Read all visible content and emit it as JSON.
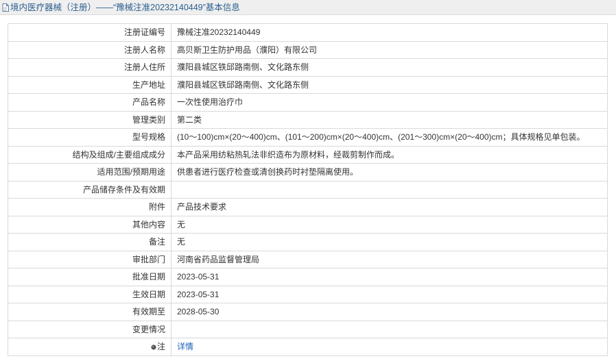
{
  "header": {
    "icon": "document-icon",
    "title": "境内医疗器械（注册）——“豫械注准20232140449”基本信息"
  },
  "rows": [
    {
      "label": "注册证编号",
      "value": "豫械注准20232140449"
    },
    {
      "label": "注册人名称",
      "value": "高贝斯卫生防护用品（濮阳）有限公司"
    },
    {
      "label": "注册人住所",
      "value": "濮阳县城区铁邱路南侧、文化路东侧"
    },
    {
      "label": "生产地址",
      "value": "濮阳县城区铁邱路南侧、文化路东侧"
    },
    {
      "label": "产品名称",
      "value": "一次性使用治疗巾"
    },
    {
      "label": "管理类别",
      "value": "第二类"
    },
    {
      "label": "型号规格",
      "value": "(10～100)cm×(20～400)cm、(101～200)cm×(20～400)cm、(201～300)cm×(20～400)cm；具体规格见单包装。"
    },
    {
      "label": "结构及组成/主要组成成分",
      "value": "本产品采用纺粘热轧法非织造布为原材料，经裁剪制作而成。"
    },
    {
      "label": "适用范围/预期用途",
      "value": "供患者进行医疗检查或清创换药时衬垫隔离使用。"
    },
    {
      "label": "产品储存条件及有效期",
      "value": ""
    },
    {
      "label": "附件",
      "value": "产品技术要求"
    },
    {
      "label": "其他内容",
      "value": "无"
    },
    {
      "label": "备注",
      "value": "无"
    },
    {
      "label": "审批部门",
      "value": "河南省药品监督管理局"
    },
    {
      "label": "批准日期",
      "value": "2023-05-31"
    },
    {
      "label": "生效日期",
      "value": "2023-05-31"
    },
    {
      "label": "有效期至",
      "value": "2028-05-30"
    },
    {
      "label": "变更情况",
      "value": ""
    }
  ],
  "note": {
    "icon": "bullet-icon",
    "label": "注",
    "link_text": "详情"
  },
  "colors": {
    "header_bg": "#efefef",
    "header_border": "#dcdcdc",
    "title": "#2b5f8f",
    "border": "#d9d9d9",
    "text": "#333333",
    "link": "#1c62b9",
    "icon": "#555555"
  }
}
